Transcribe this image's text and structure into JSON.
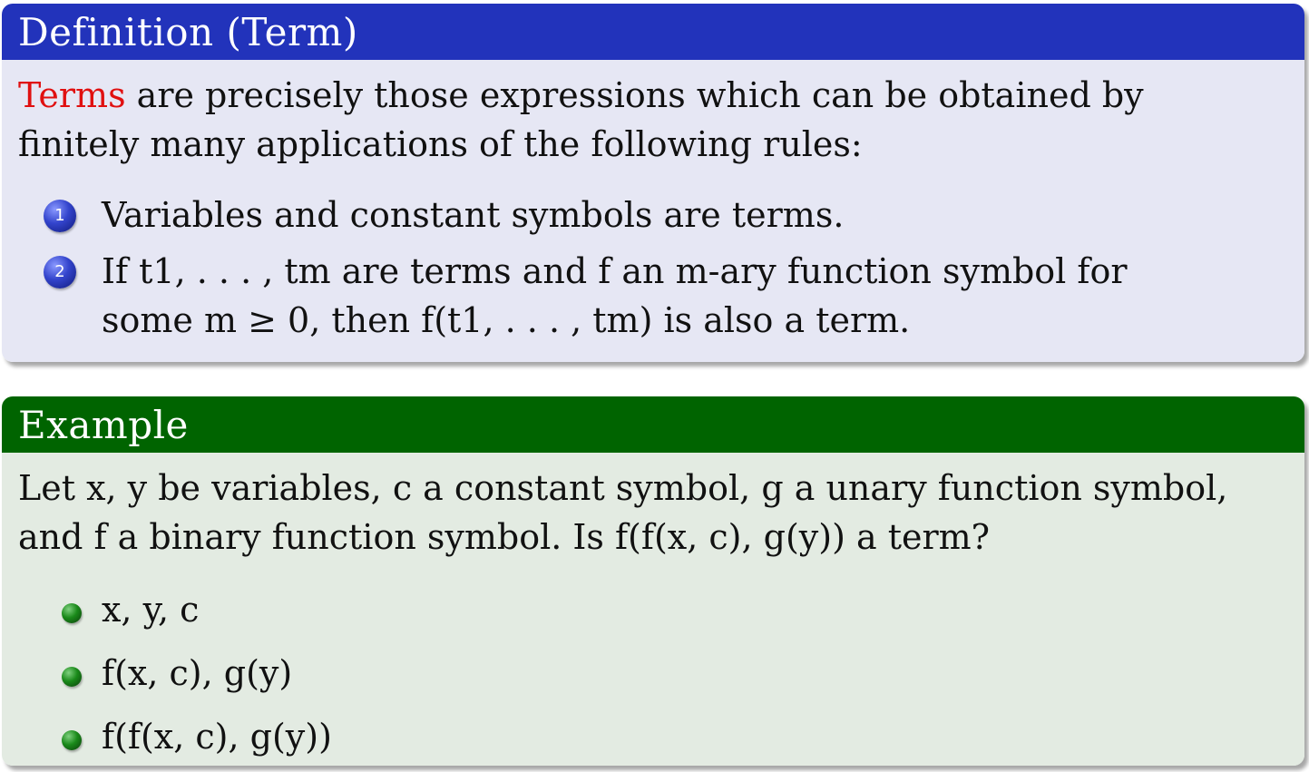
{
  "definition": {
    "title": "Definition  (Term)",
    "highlight": "Terms",
    "intro_rest": " are precisely those expressions which can be obtained by",
    "intro_line2": "finitely many applications of the following rules:",
    "rules": [
      {
        "number": "1",
        "text": "Variables and constant symbols are terms."
      },
      {
        "number": "2",
        "line1": "If t1, . . . , tm are terms and f an m-ary function symbol for",
        "line2": "some m ≥  0, then f(t1, . . . , tm) is also a  term."
      }
    ],
    "colors": {
      "header": "#2233bb",
      "body": "#e6e7f4",
      "highlight": "#e01010"
    }
  },
  "example": {
    "title": "Example",
    "line1": "Let x, y be variables, c a  constant symbol, g a  unary function symbol,",
    "line2": "and f a  binary function symbol. Is f(f(x, c), g(y)) a  term?",
    "items": [
      {
        "text": "x, y, c"
      },
      {
        "text": "f(x, c),  g(y)"
      },
      {
        "text": "f(f(x, c), g(y))"
      }
    ],
    "colors": {
      "header": "#006400",
      "body": "#e3ebe2"
    }
  }
}
